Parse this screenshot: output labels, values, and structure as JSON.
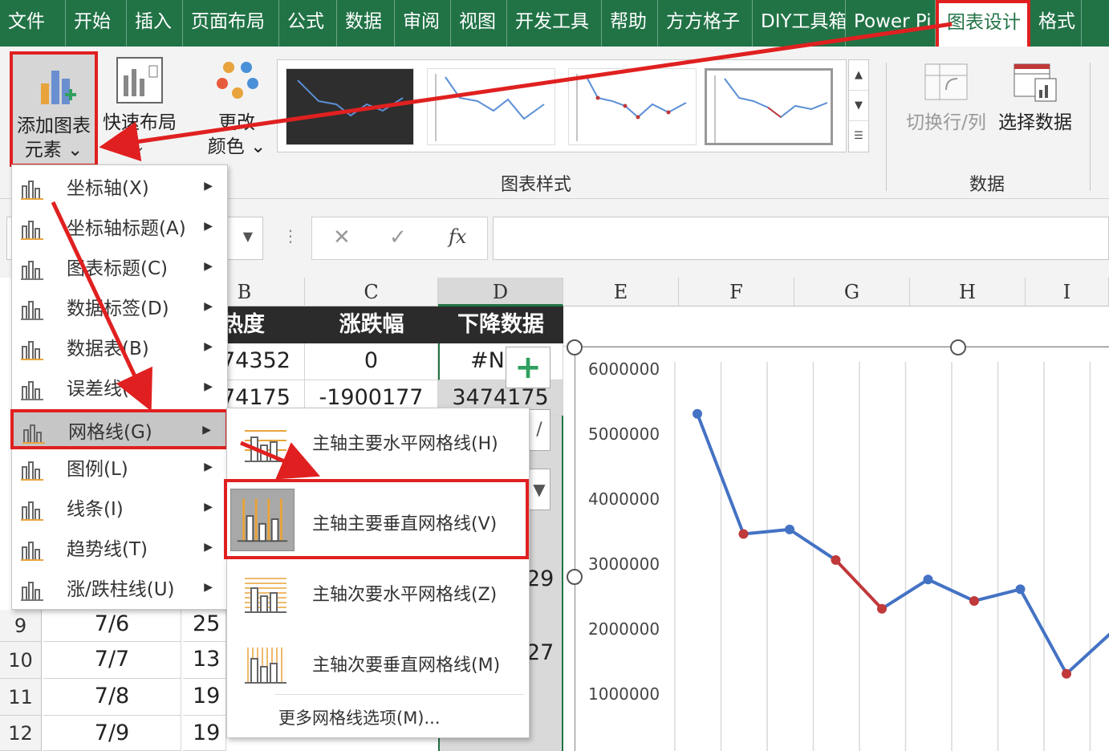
{
  "tabs": [
    "文件",
    "开始",
    "插入",
    "页面布局",
    "公式",
    "数据",
    "审阅",
    "视图",
    "开发工具",
    "帮助",
    "方方格子",
    "DIY工具箱",
    "Power Pi",
    "图表设计",
    "格式"
  ],
  "active_tab": "图表设计",
  "ribbon": {
    "add_chart_element": [
      "添加图表",
      "元素 ⌄"
    ],
    "quick_layout": [
      "快速布局",
      "⌄"
    ],
    "change_colors": [
      "更改",
      "颜色 ⌄"
    ],
    "chart_styles_label": "图表样式",
    "switch_row_col": "切换行/列",
    "select_data": "选择数据",
    "data_group_label": "数据"
  },
  "formula_bar": {
    "cancel": "✕",
    "confirm": "✓",
    "fx": "fx"
  },
  "columns": [
    "B",
    "C",
    "D",
    "E",
    "F",
    "G",
    "H",
    "I"
  ],
  "table_headers": [
    "热度",
    "涨跌幅",
    "下降数据"
  ],
  "visible_rows": [
    {
      "b": "74352",
      "c": "0",
      "d": "#N"
    },
    {
      "b": "74175",
      "c": "-1900177",
      "d": "3474175"
    }
  ],
  "partial_cells": [
    "29",
    "27"
  ],
  "lower_rows": [
    {
      "num": "9",
      "a": "7/6",
      "b": "25"
    },
    {
      "num": "10",
      "a": "7/7",
      "b": "13"
    },
    {
      "num": "11",
      "a": "7/8",
      "b": "19"
    },
    {
      "num": "12",
      "a": "7/9",
      "b": "19"
    }
  ],
  "menu": {
    "items": [
      "坐标轴(X)",
      "坐标轴标题(A)",
      "图表标题(C)",
      "数据标签(D)",
      "数据表(B)",
      "误差线(E)",
      "网格线(G)",
      "图例(L)",
      "线条(I)",
      "趋势线(T)",
      "涨/跌柱线(U)"
    ]
  },
  "submenu": {
    "items": [
      "主轴主要水平网格线(H)",
      "主轴主要垂直网格线(V)",
      "主轴次要水平网格线(Z)",
      "主轴次要垂直网格线(M)"
    ],
    "more": "更多网格线选项(M)..."
  },
  "colors": {
    "excel_green": "#217346",
    "highlight_red": "#e02020",
    "line_blue": "#4472c4",
    "line_red": "#c0393b"
  },
  "chart_data": {
    "type": "line",
    "yticks": [
      "6000000",
      "5000000",
      "4000000",
      "3000000",
      "2000000",
      "1000000"
    ],
    "ylim": [
      0,
      6000000
    ],
    "values": [
      5300000,
      3450000,
      3520000,
      3050000,
      2300000,
      2750000,
      2420000,
      2600000,
      1300000,
      1950000
    ],
    "red_segments": [
      [
        3,
        4
      ]
    ],
    "red_points": [
      1,
      3,
      4,
      6,
      8
    ],
    "gridlines": "vertical"
  }
}
